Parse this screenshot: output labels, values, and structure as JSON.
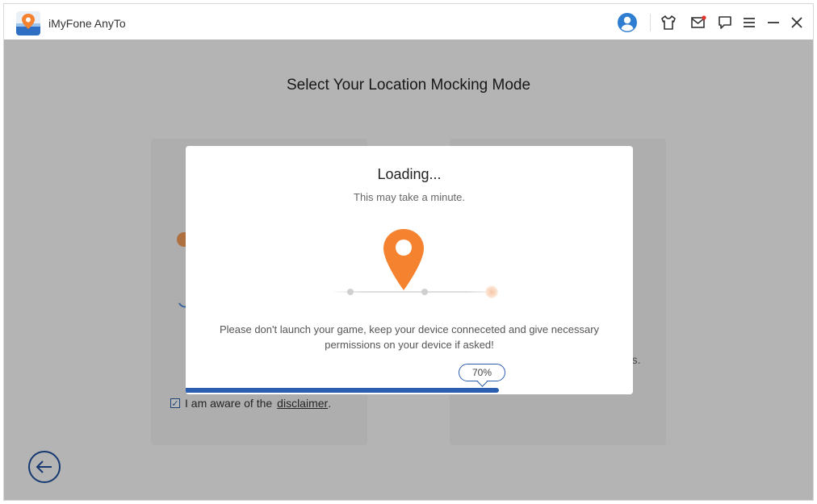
{
  "app": {
    "title": "iMyFone AnyTo"
  },
  "titlebar": {
    "icons": [
      "user-avatar-icon",
      "shirt-icon",
      "mail-icon",
      "feedback-icon",
      "menu-icon",
      "minimize-icon",
      "close-icon"
    ],
    "accent": "#2f7dd1"
  },
  "page": {
    "title": "Select Your Location Mocking Mode",
    "right_card_hint": "ops.",
    "checkbox_label": "I am aware of the",
    "disclaimer_link": "disclaimer",
    "disclaimer_suffix": "."
  },
  "modal": {
    "title": "Loading...",
    "subtitle": "This may take a minute.",
    "message": "Please don't launch your game, keep your device conneceted and give necessary permissions on your device if asked!",
    "progress": {
      "value": 0.7,
      "label": "70%"
    },
    "pin_color": "#f5822f",
    "progress_color": "#2c5eb0"
  }
}
